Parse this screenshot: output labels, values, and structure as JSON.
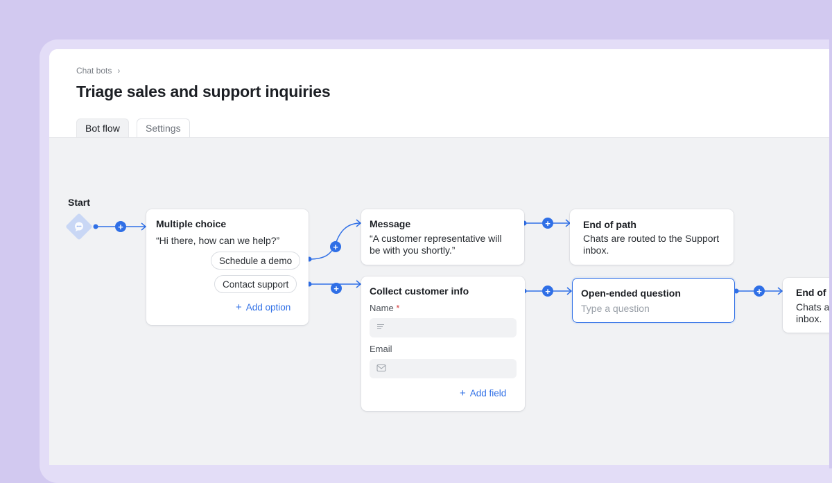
{
  "breadcrumb": {
    "label": "Chat bots",
    "separator": "›"
  },
  "page": {
    "title": "Triage sales and support inquiries"
  },
  "tabs": [
    {
      "label": "Bot flow",
      "active": true
    },
    {
      "label": "Settings",
      "active": false
    }
  ],
  "start": {
    "label": "Start",
    "icon": "chat-bubble-icon"
  },
  "nodes": {
    "multiple_choice": {
      "title": "Multiple choice",
      "prompt": "“Hi there, how can we help?”",
      "options": [
        "Schedule a demo",
        "Contact support"
      ],
      "add_option": "Add option"
    },
    "message": {
      "title": "Message",
      "text_line1": "“A customer representative will",
      "text_line2": "be with you shortly.”"
    },
    "end_of_path_1": {
      "title": "End of path",
      "text_line1": "Chats are routed to the Support",
      "text_line2": "inbox."
    },
    "collect_info": {
      "title": "Collect customer info",
      "name_label": "Name",
      "required_mark": "*",
      "email_label": "Email",
      "add_field": "Add field"
    },
    "open_question": {
      "title": "Open-ended question",
      "placeholder": "Type a question"
    },
    "end_of_path_2": {
      "title": "End of p",
      "text_line1": "Chats a",
      "text_line2": "inbox."
    }
  },
  "add_symbol": "+",
  "colors": {
    "accent": "#2f6fe6",
    "canvas": "#f1f2f4",
    "background": "#d2c9f0"
  }
}
